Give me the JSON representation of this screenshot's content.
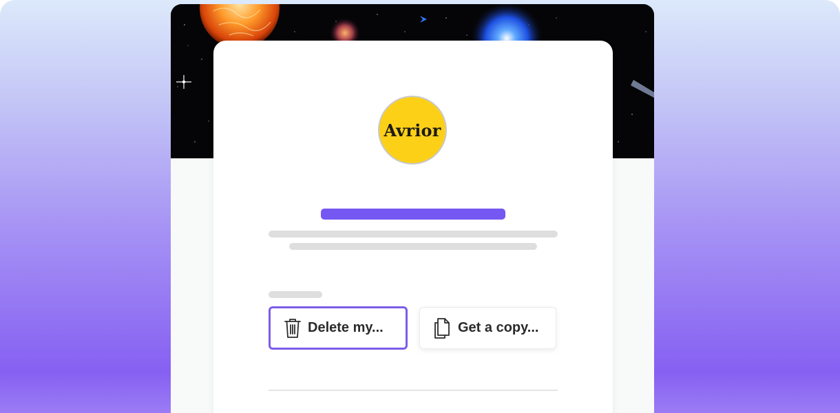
{
  "brand": {
    "logo_text": "Avrior",
    "logo_color": "#fdd018"
  },
  "actions": {
    "delete_label": "Delete my...",
    "copy_label": "Get a copy..."
  },
  "colors": {
    "accent": "#7557f1",
    "banner": "#050507",
    "placeholder": "#dedede"
  },
  "icons": {
    "delete": "trash-icon",
    "copy": "documents-icon"
  }
}
